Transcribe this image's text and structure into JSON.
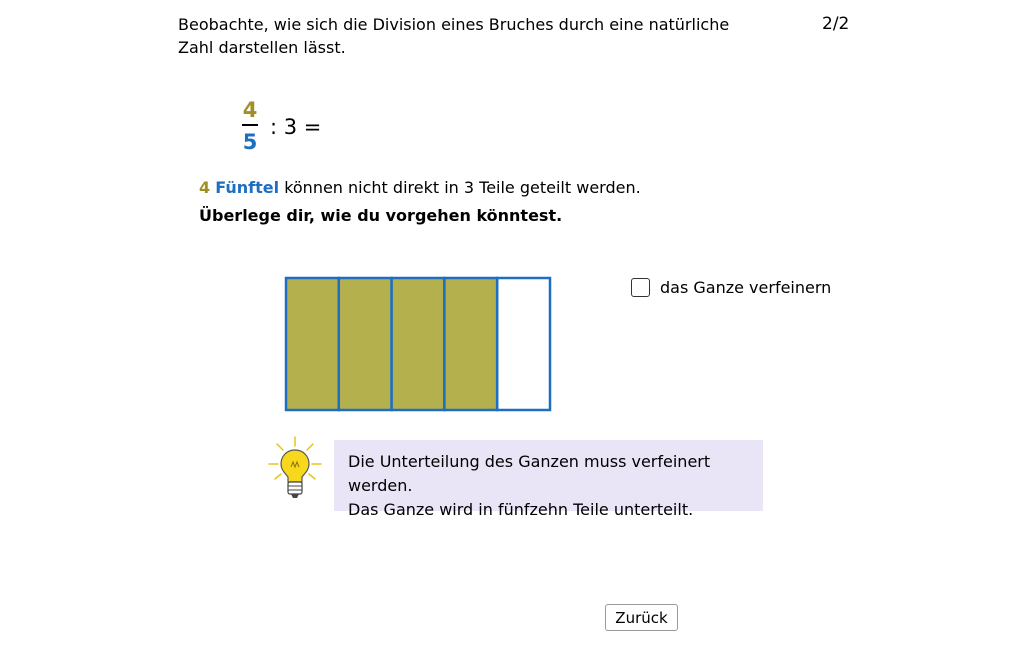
{
  "header": {
    "instruction": "Beobachte, wie sich die Division eines Bruches durch eine natürliche Zahl darstellen lässt.",
    "page_indicator": "2/2"
  },
  "equation": {
    "numerator": "4",
    "denominator": "5",
    "rest": ": 3 ="
  },
  "explanation": {
    "count": "4",
    "unit": "Fünftel",
    "rest": "können nicht direkt in 3 Teile geteilt werden.",
    "prompt": "Überlege dir, wie du vorgehen könntest."
  },
  "fraction_model": {
    "total_parts": 5,
    "filled_parts": 4,
    "fill_color": "#b5b04e",
    "border_color": "#1e6fc1"
  },
  "refine_checkbox": {
    "label": "das Ganze verfeinern",
    "checked": false
  },
  "hint": {
    "line1": "Die Unterteilung des Ganzen muss verfeinert werden.",
    "line2": "Das Ganze wird in fünfzehn Teile unterteilt."
  },
  "navigation": {
    "back_label": "Zurück"
  }
}
